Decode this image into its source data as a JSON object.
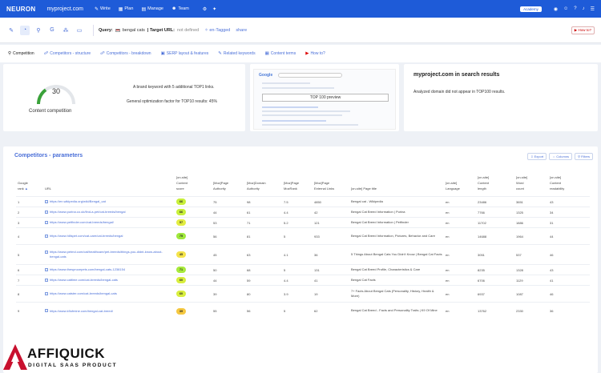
{
  "topbar": {
    "logo": "NEURON",
    "project": "myproject.com",
    "nav": [
      {
        "icon": "pencil-icon",
        "glyph": "✎",
        "label": "Write"
      },
      {
        "icon": "calendar-icon",
        "glyph": "▦",
        "label": "Plan"
      },
      {
        "icon": "grid-icon",
        "glyph": "▤",
        "label": "Manage"
      },
      {
        "icon": "team-icon",
        "glyph": "☻",
        "label": "Team"
      }
    ],
    "academy": "Academy"
  },
  "toolbar": {
    "query_label": "Query:",
    "query_value": "bengal cats",
    "target_label": "| Target URL:",
    "target_value": "not defined",
    "engine": "✧ en-Tagged",
    "share": "share",
    "howto": "How to?"
  },
  "tabs": [
    {
      "icon": "competition-icon",
      "glyph": "⚲",
      "label": "Competition",
      "active": true
    },
    {
      "icon": "structure-icon",
      "glyph": "☍",
      "label": "Competitors - structure"
    },
    {
      "icon": "breakdown-icon",
      "glyph": "☍",
      "label": "Competitors - breakdown"
    },
    {
      "icon": "serp-icon",
      "glyph": "▣",
      "label": "SERP layout & features"
    },
    {
      "icon": "keywords-icon",
      "glyph": "✎",
      "label": "Related keywords"
    },
    {
      "icon": "terms-icon",
      "glyph": "▦",
      "label": "Content terms"
    },
    {
      "icon": "youtube-icon",
      "glyph": "▶",
      "label": "How to?"
    }
  ],
  "competition": {
    "score": "30",
    "score_fraction": 0.3,
    "caption": "Content competition",
    "line1": "A brand keyword with 5 additional TOP1 links.",
    "line2": "General optimization factor for TOP10 results: 45%"
  },
  "preview": {
    "brand": "Google",
    "button": "TOP 100 preview"
  },
  "results": {
    "title": "myproject.com in search results",
    "message": "Analyzed domain did not appear in TOP100 results."
  },
  "table": {
    "title": "Competitors - parameters",
    "buttons": [
      "Export",
      "Columns",
      "Filters"
    ],
    "headers": [
      "Google\nrank",
      "URL",
      "[on-site]\nContent\nscore",
      "[Moz]Page\nAuthority",
      "[Moz]Domain\nAuthority",
      "[Moz]Page\nMozRank",
      "[Moz]Page\nExternal Links",
      "[on-site] Page title",
      "[on-site]\nLanguage",
      "[on-site]\nContent\nlength",
      "[on-site]\nWord\ncount",
      "[on-site]\nContent\nreadability"
    ],
    "rows": [
      {
        "rank": "1",
        "url": "https://en.wikipedia.org/wiki/Bengal_cat",
        "score": "66",
        "score_color": "#c8ef3a",
        "pa": "75",
        "da": "98",
        "mr": "7.5",
        "ext": "4850",
        "title": "Bengal cat - Wikipedia",
        "lang": "en",
        "len": "23486",
        "words": "3651",
        "read": "43"
      },
      {
        "rank": "2",
        "url": "https://www.purina.co.uk/find-a-pet/cat-breeds/bengal",
        "score": "66",
        "score_color": "#c8ef3a",
        "pa": "44",
        "da": "61",
        "mr": "4.4",
        "ext": "42",
        "title": "Bengal Cat Breed Information | Purina",
        "lang": "en",
        "len": "7766",
        "words": "1325",
        "read": "34"
      },
      {
        "rank": "3",
        "url": "https://www.petfinder.com/cat-breeds/bengal/",
        "score": "57",
        "score_color": "#e2ed40",
        "pa": "53",
        "da": "71",
        "mr": "5.2",
        "ext": "121",
        "title": "Bengal Cat Breed Information | Petfinder",
        "lang": "en",
        "len": "11702",
        "words": "1886",
        "read": "31"
      },
      {
        "rank": "4",
        "url": "https://www.hillspet.com/cat-care/cat-breeds/bengal",
        "score": "75",
        "score_color": "#9fe83c",
        "pa": "56",
        "da": "81",
        "mr": "5",
        "ext": "933",
        "title": "Bengal Cat Breed Information, Pictures, Behavior and Care",
        "lang": "en",
        "len": "14688",
        "words": "1964",
        "read": "44"
      },
      {
        "rank": "5",
        "url": "https://www.petmd.com/cat/healthcare/pet-breeds/things-you-didnt-know-about-bengal-cats",
        "score": "45",
        "score_color": "#f4e34a",
        "pa": "45",
        "da": "63",
        "mr": "4.1",
        "ext": "36",
        "title": "5 Things About Bengal Cats You Didn't Know | Bengal Cat Facts",
        "lang": "en",
        "len": "3051",
        "words": "537",
        "read": "46"
      },
      {
        "rank": "6",
        "url": "https://www.thesprucepets.com/bengal-cats-1238154",
        "score": "71",
        "score_color": "#a8ea3c",
        "pa": "50",
        "da": "68",
        "mr": "5",
        "ext": "131",
        "title": "Bengal Cat Breed Profile, Characteristics & Care",
        "lang": "en",
        "len": "8235",
        "words": "1328",
        "read": "43"
      },
      {
        "rank": "7",
        "url": "https://www.cattime.com/cat-breeds/bengal-cats",
        "score": "60",
        "score_color": "#d8ee3e",
        "pa": "44",
        "da": "59",
        "mr": "4.4",
        "ext": "41",
        "title": "Bengal Cat Facts",
        "lang": "en",
        "len": "6706",
        "words": "1129",
        "read": "41"
      },
      {
        "rank": "8",
        "url": "https://www.catster.com/cat-breeds/bengal-cats",
        "score": "60",
        "score_color": "#d8ee3e",
        "pa": "39",
        "da": "80",
        "mr": "3.9",
        "ext": "19",
        "title": "7+ Facts About Bengal Cats (Personality, History, Health & More)",
        "lang": "en",
        "len": "6937",
        "words": "1087",
        "read": "46"
      },
      {
        "rank": "9",
        "url": "https://www.k9ofmine.com/bengal-cat-breed/",
        "score": "39",
        "score_color": "#f5c840",
        "pa": "55",
        "da": "56",
        "mr": "5",
        "ext": "62",
        "title": "Bengal Cat Breed - Facts and Personality Traits | K9 Of Mine",
        "lang": "en",
        "len": "13762",
        "words": "2330",
        "read": "36"
      }
    ]
  },
  "brand": {
    "name": "AFFIQUICK",
    "subtitle": "DIGITAL SAAS PRODUCT",
    "accent": "#c8102e"
  },
  "colors": {
    "topbar": "#1e5bd8",
    "accent": "#4a6fd8",
    "gauge_fill": "#3aa23a"
  }
}
